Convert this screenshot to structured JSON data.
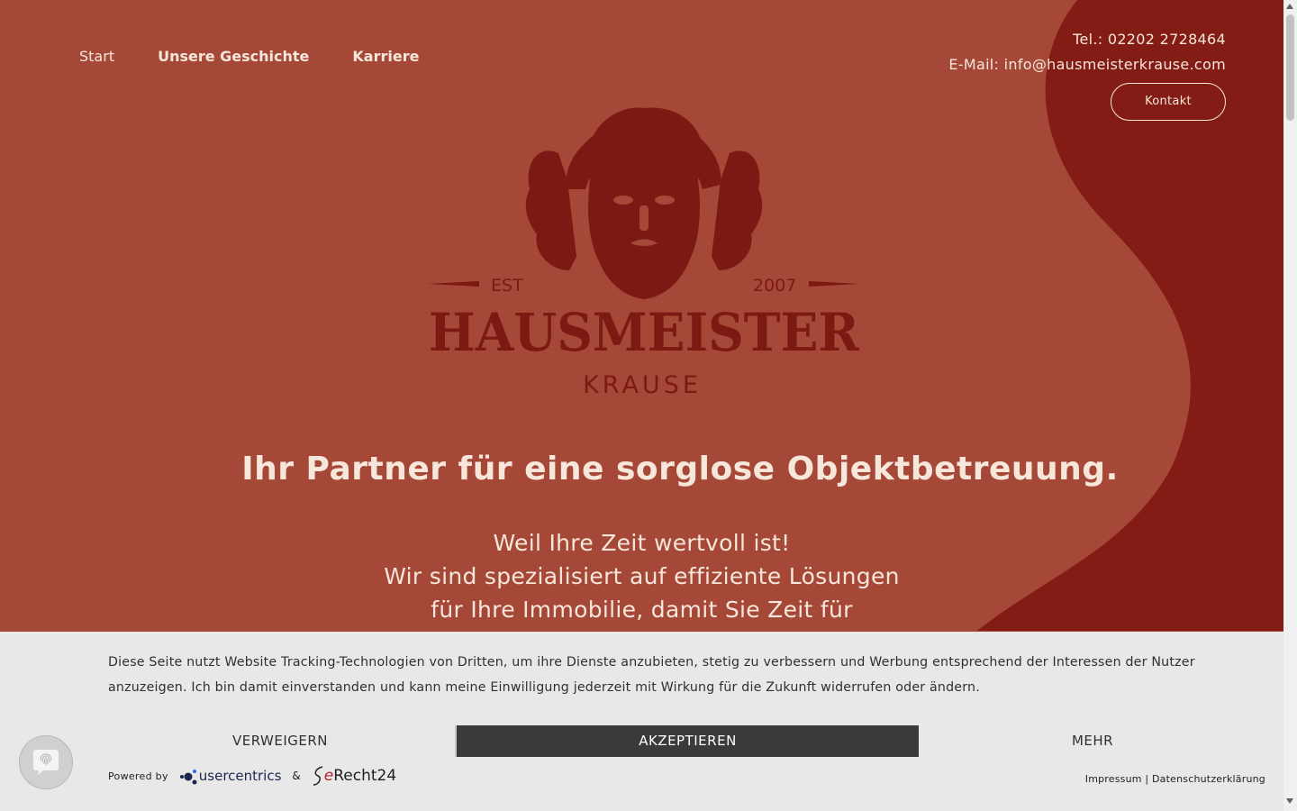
{
  "nav": {
    "items": [
      {
        "label": "Start",
        "bold": false
      },
      {
        "label": "Unsere Geschichte",
        "bold": true
      },
      {
        "label": "Karriere",
        "bold": true
      }
    ]
  },
  "contact": {
    "phone": "Tel.: 02202 2728464",
    "email": "E-Mail: info@hausmeisterkrause.com",
    "button_label": "Kontakt"
  },
  "logo": {
    "est_left": "EST",
    "est_right": "2007",
    "name": "HAUSMEISTER",
    "sub": "KRAUSE"
  },
  "hero": {
    "headline": "Ihr Partner für eine sorglose Objektbetreuung.",
    "lines": [
      "Weil Ihre Zeit wertvoll ist!",
      "Wir sind spezialisiert auf effiziente Lösungen",
      "für Ihre Immobilie, damit Sie Zeit für"
    ]
  },
  "cookie": {
    "text": "Diese Seite nutzt Website Tracking-Technologien von Dritten, um ihre Dienste anzubieten, stetig zu verbessern und Werbung entsprechend der Interessen der Nutzer anzuzeigen. Ich bin damit einverstanden und kann meine Einwilligung jederzeit mit Wirkung für die Zukunft widerrufen oder ändern.",
    "deny_label": "VERWEIGERN",
    "accept_label": "AKZEPTIEREN",
    "more_label": "MEHR",
    "powered_by": "Powered by",
    "usercentrics": "usercentrics",
    "amp": "&",
    "erecht_e": "e",
    "erecht_rest": "Recht24",
    "impressum": "Impressum",
    "separator": "|",
    "datenschutz": "Datenschutzerklärung"
  },
  "colors": {
    "background": "#a54838",
    "wave": "#821c14",
    "logo": "#7a1a12",
    "text_light": "#f7e6da",
    "banner": "#e8e8e8",
    "accept_bg": "#3a3a3a"
  },
  "icons": {
    "fab": "fingerprint-icon"
  }
}
